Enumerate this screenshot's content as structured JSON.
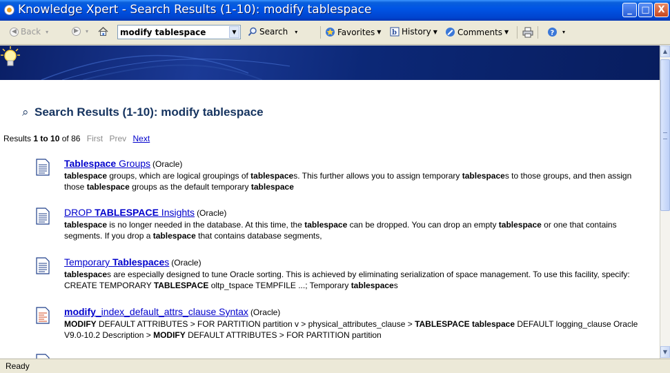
{
  "window": {
    "title": "Knowledge Xpert - Search Results (1-10): modify tablespace",
    "minimize": "_",
    "maximize": "□",
    "close": "X"
  },
  "toolbar": {
    "back_label": "Back",
    "search_value": "modify tablespace",
    "search_label": "Search",
    "favorites_label": "Favorites",
    "history_label": "History",
    "comments_label": "Comments"
  },
  "page": {
    "heading": "Search Results (1-10): modify tablespace",
    "pager": {
      "prefix": "Results ",
      "from": "1",
      "to_word": " to ",
      "to": "10",
      "of_word": " of ",
      "total": "86",
      "first": "First",
      "prev": "Prev",
      "next": "Next"
    }
  },
  "results": [
    {
      "icon": "document-icon",
      "title_html": "<b>Tablespace</b> Groups",
      "source": "(Oracle)",
      "snippet_html": "<b>tablespace</b> groups, which are logical groupings of <b>tablespace</b>s. This further allows you to assign temporary <b>tablespace</b>s to those groups, and then assign those <b>tablespace</b> groups as the default temporary <b>tablespace</b>"
    },
    {
      "icon": "document-icon",
      "title_html": "DROP <b>TABLESPACE</b> Insights",
      "source": "(Oracle)",
      "snippet_html": "<b>tablespace</b> is no longer needed in the database. At this time, the <b>tablespace</b> can be dropped. You can drop an empty <b>tablespace</b> or one that contains segments. If you drop a <b>tablespace</b> that contains database segments,"
    },
    {
      "icon": "document-icon",
      "title_html": "Temporary <b>Tablespace</b>s",
      "source": "(Oracle)",
      "snippet_html": "<b>tablespace</b>s are especially designed to tune Oracle sorting. This is achieved by eliminating serialization of space management. To use this facility, specify: CREATE TEMPORARY <b>TABLESPACE</b> oltp_tspace TEMPFILE ...; Temporary <b>tablespace</b>s"
    },
    {
      "icon": "syntax-document-icon",
      "title_html": "<b>modify</b>_index_default_attrs_clause Syntax",
      "source": "(Oracle)",
      "snippet_html": "<b>MODIFY</b> DEFAULT ATTRIBUTES &gt; FOR PARTITION partition v &gt; physical_attributes_clause &gt; <b>TABLESPACE tablespace</b> DEFAULT logging_clause Oracle V9.0-10.2 Description &gt; <b>MODIFY</b> DEFAULT ATTRIBUTES &gt; FOR PARTITION partition"
    }
  ],
  "status": {
    "text": "Ready"
  },
  "colors": {
    "link": "#0000cc",
    "heading": "#15335f",
    "banner": "#0c2877",
    "titlebar": "#0055e5"
  }
}
